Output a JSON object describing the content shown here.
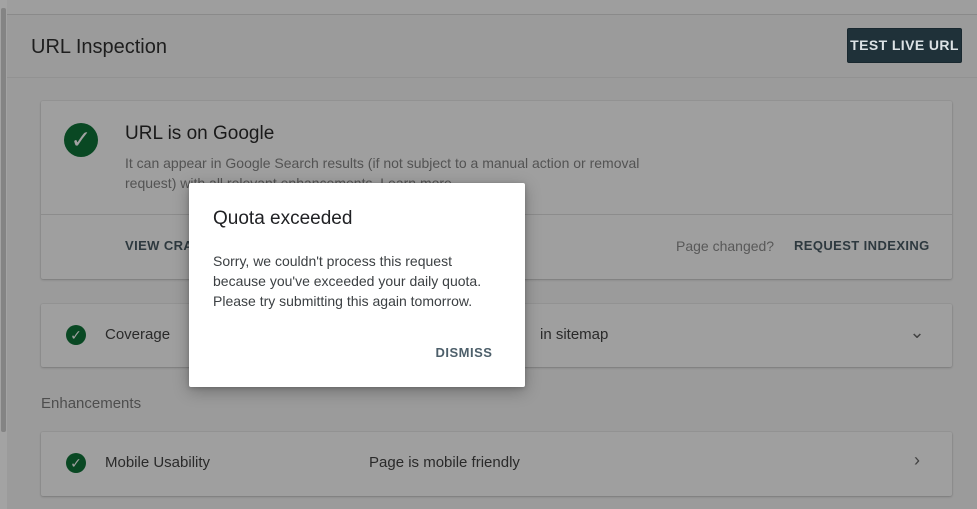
{
  "header": {
    "title": "URL Inspection",
    "test_live_url": "TEST LIVE URL"
  },
  "status_card": {
    "title": "URL is on Google",
    "description": "It can appear in Google Search results (if not subject to a manual action or removal request) with all relevant enhancements.",
    "learn_more": "Learn more",
    "view_crawled": "VIEW CRA",
    "page_changed": "Page changed?",
    "request_indexing": "REQUEST INDEXING"
  },
  "coverage": {
    "label": "Coverage",
    "value": "in sitemap"
  },
  "enhancements": {
    "heading": "Enhancements",
    "mobile_usability_label": "Mobile Usability",
    "mobile_usability_value": "Page is mobile friendly"
  },
  "dialog": {
    "title": "Quota exceeded",
    "body": "Sorry, we couldn't process this request because you've exceeded your daily quota. Please try submitting this again tomorrow.",
    "dismiss": "DISMISS"
  },
  "icons": {
    "success": "check-circle-icon",
    "expand": "chevron-down-icon",
    "navigate": "chevron-right-icon"
  },
  "colors": {
    "success": "#0a4a24",
    "button_dark": "#20323b",
    "action_text": "#2f3b41"
  }
}
